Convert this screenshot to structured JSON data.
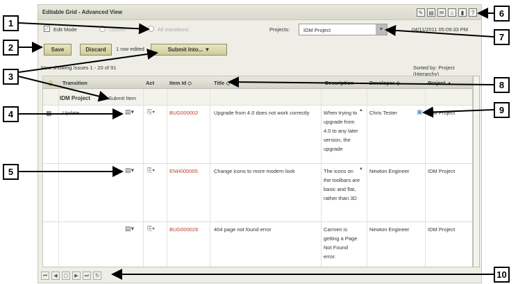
{
  "window": {
    "title": "Editable Grid - Advanced View"
  },
  "toolbar_icons": [
    "edit-icon",
    "print-icon",
    "email-icon",
    "home-icon",
    "book-icon",
    "help-icon"
  ],
  "options": {
    "edit_mode_label": "Edit Mode",
    "update_label": "Update",
    "all_transitions_label": "All transitions",
    "projects_label": "Projects:",
    "projects_value": "IDM Project",
    "timestamp": "04/11/2011 05:09:33 PM"
  },
  "actions": {
    "save_label": "Save",
    "discard_label": "Discard",
    "rows_edited": "1 row edited",
    "submit_label": "Submit Into..."
  },
  "status": {
    "showing": "Now showing Issues 1 - 20 of 91",
    "sorted_by": "Sorted by:  Project (Hierarchy)"
  },
  "grid": {
    "headers": {
      "transition": "Transition",
      "act": "Act",
      "item_id": "Item Id ◇",
      "title": "Title ◇",
      "description": "Description",
      "developer": "Developer ◇",
      "project": "Project ▲"
    },
    "group": {
      "name": "IDM Project",
      "action": "Submit Item"
    },
    "rows": [
      {
        "transition": "Update",
        "item_id": "BUG000002",
        "title": "Upgrade from 4.0 does not work correctly",
        "description": "When trying to upgrade from 4.0 to any later version, the upgrade",
        "developer": "Chris Tester",
        "project": "IDM Project"
      },
      {
        "transition": "",
        "item_id": "ENH000005",
        "title": "Change icons to more modern look",
        "description": "The icons on the toolbars are basic and flat, rather than 3D",
        "developer": "Newton Engineer",
        "project": "IDM Project"
      },
      {
        "transition": "",
        "item_id": "BUG000028",
        "title": "404 page not found error",
        "description": "Carmen is getting a Page Not Found error.",
        "developer": "Newton Engineer",
        "project": "IDM Project"
      }
    ]
  },
  "callouts": [
    "1",
    "2",
    "3",
    "4",
    "5",
    "6",
    "7",
    "8",
    "9",
    "10"
  ]
}
